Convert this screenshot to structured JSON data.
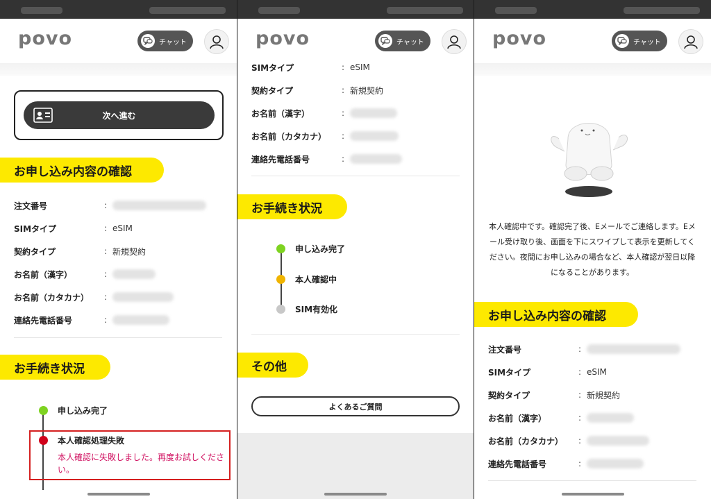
{
  "brand": {
    "logo": "povo",
    "chat_label": "チャット"
  },
  "colors": {
    "accent_yellow": "#fde900",
    "done_green": "#7ed321",
    "in_progress_orange": "#f0b400",
    "pending_gray": "#c8c8c8",
    "error_red": "#d0021b"
  },
  "phone1": {
    "next_button": "次へ進む",
    "order_heading": "お申し込み内容の確認",
    "rows": [
      {
        "label": "注文番号",
        "value": ""
      },
      {
        "label": "SIMタイプ",
        "value": "eSIM"
      },
      {
        "label": "契約タイプ",
        "value": "新規契約"
      },
      {
        "label": "お名前（漢字）",
        "value": ""
      },
      {
        "label": "お名前（カタカナ）",
        "value": ""
      },
      {
        "label": "連絡先電話番号",
        "value": ""
      }
    ],
    "status_heading": "お手続き状況",
    "steps": [
      {
        "label": "申し込み完了",
        "status": "done"
      },
      {
        "label": "本人確認処理失敗",
        "status": "error"
      }
    ],
    "error_message": "本人確認に失敗しました。再度お試しください。"
  },
  "phone2": {
    "rows": [
      {
        "label": "SIMタイプ",
        "value": "eSIM"
      },
      {
        "label": "契約タイプ",
        "value": "新規契約"
      },
      {
        "label": "お名前（漢字）",
        "value": ""
      },
      {
        "label": "お名前（カタカナ）",
        "value": ""
      },
      {
        "label": "連絡先電話番号",
        "value": ""
      }
    ],
    "status_heading": "お手続き状況",
    "steps": [
      {
        "label": "申し込み完了",
        "status": "done"
      },
      {
        "label": "本人確認中",
        "status": "in-progress"
      },
      {
        "label": "SIM有効化",
        "status": "pending"
      }
    ],
    "other_heading": "その他",
    "faq_button": "よくあるご質問"
  },
  "phone3": {
    "message": "本人確認中です。確認完了後、Eメールでご連絡します。Eメール受け取り後、画面を下にスワイプして表示を更新してください。夜間にお申し込みの場合など、本人確認が翌日以降になることがあります。",
    "order_heading": "お申し込み内容の確認",
    "rows": [
      {
        "label": "注文番号",
        "value": ""
      },
      {
        "label": "SIMタイプ",
        "value": "eSIM"
      },
      {
        "label": "契約タイプ",
        "value": "新規契約"
      },
      {
        "label": "お名前（漢字）",
        "value": ""
      },
      {
        "label": "お名前（カタカナ）",
        "value": ""
      },
      {
        "label": "連絡先電話番号",
        "value": ""
      }
    ]
  }
}
